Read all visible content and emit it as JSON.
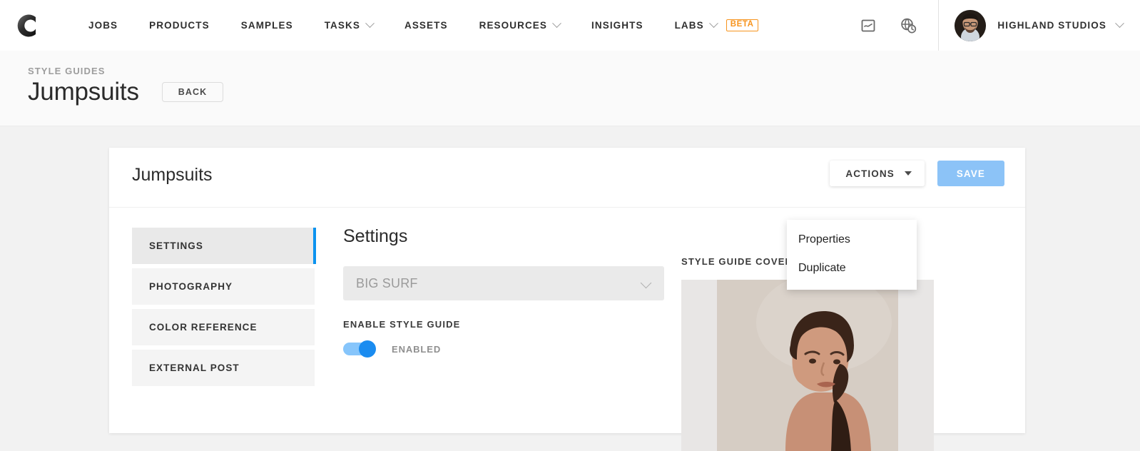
{
  "topnav": {
    "logo_alt": "company-logo",
    "items": [
      {
        "label": "JOBS",
        "has_caret": false
      },
      {
        "label": "PRODUCTS",
        "has_caret": false
      },
      {
        "label": "SAMPLES",
        "has_caret": false
      },
      {
        "label": "TASKS",
        "has_caret": true
      },
      {
        "label": "ASSETS",
        "has_caret": false
      },
      {
        "label": "RESOURCES",
        "has_caret": true
      },
      {
        "label": "INSIGHTS",
        "has_caret": false
      },
      {
        "label": "LABS",
        "has_caret": true,
        "badge": "BETA"
      }
    ],
    "badge_color": "#f7941e",
    "icons": [
      {
        "name": "inbox-icon"
      },
      {
        "name": "globe-clock-icon"
      }
    ],
    "account": {
      "name": "HIGHLAND STUDIOS"
    }
  },
  "page_header": {
    "breadcrumb": "STYLE GUIDES",
    "title": "Jumpsuits",
    "back_label": "BACK"
  },
  "card": {
    "title": "Jumpsuits",
    "actions_label": "ACTIONS",
    "save_label": "SAVE",
    "save_color": "#8cc3f7",
    "menu": {
      "open": true,
      "items": [
        "Properties",
        "Duplicate"
      ]
    }
  },
  "sidebar": {
    "items": [
      {
        "label": "SETTINGS",
        "active": true
      },
      {
        "label": "PHOTOGRAPHY",
        "active": false
      },
      {
        "label": "COLOR REFERENCE",
        "active": false
      },
      {
        "label": "EXTERNAL POST",
        "active": false
      }
    ],
    "active_accent": "#0c93ef"
  },
  "settings": {
    "pane_title": "Settings",
    "select": {
      "value": "BIG SURF"
    },
    "enable_label": "ENABLE STYLE GUIDE",
    "toggle": {
      "state_label": "ENABLED",
      "on": true,
      "color": "#1a8cf0"
    }
  },
  "cover": {
    "label": "STYLE GUIDE COVER"
  }
}
